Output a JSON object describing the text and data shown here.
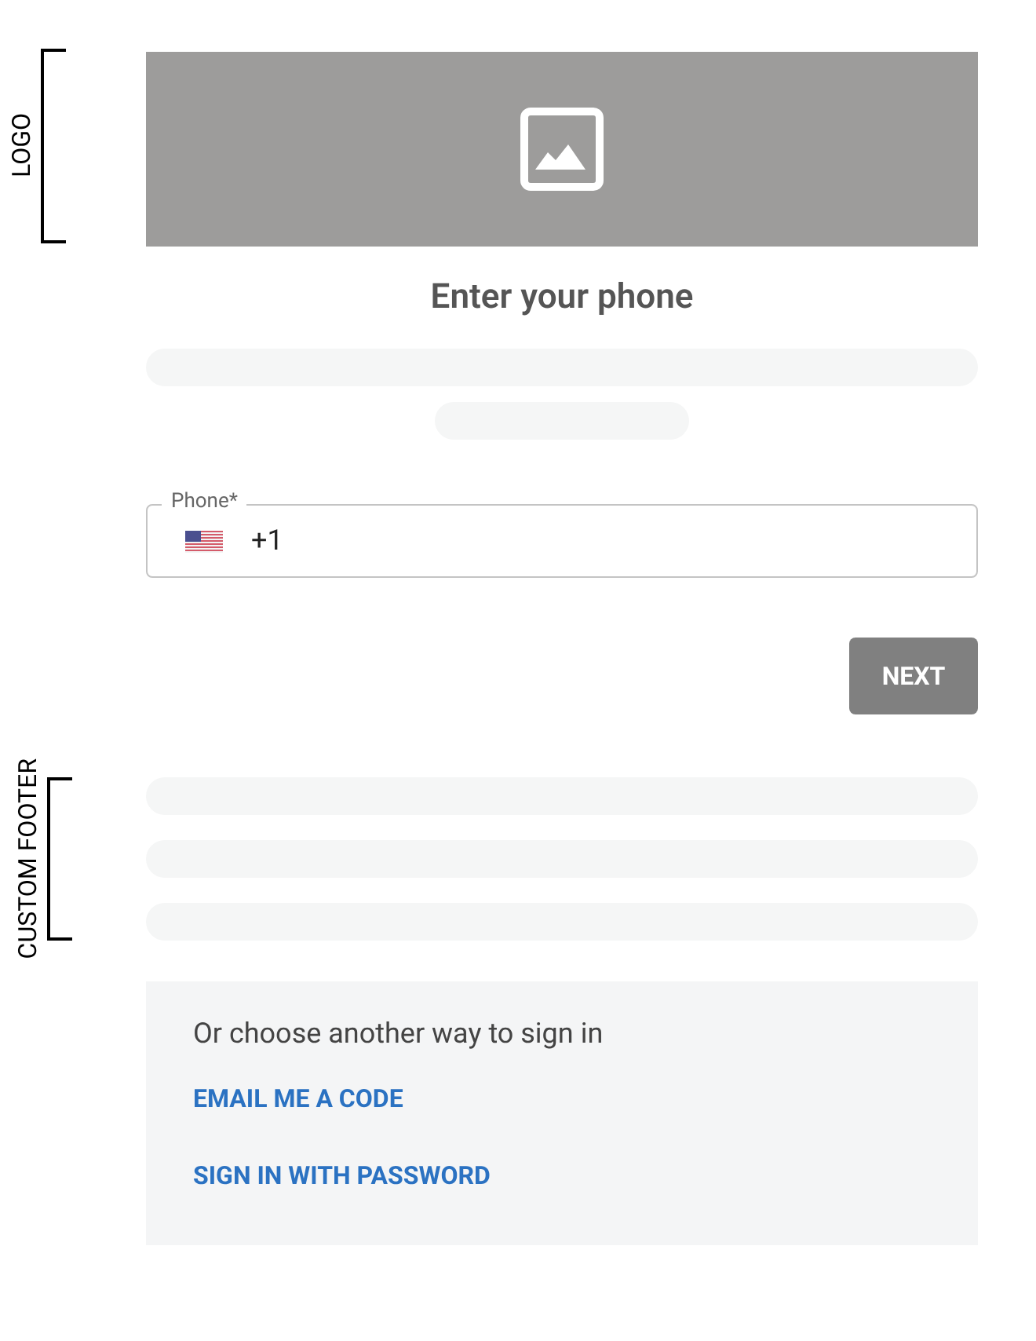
{
  "annotations": [
    {
      "kind": "logo",
      "label": "LOGO"
    },
    {
      "kind": "footer",
      "label": "CUSTOM FOOTER"
    }
  ],
  "title": "Enter your phone",
  "phone_field": {
    "label": "Phone*",
    "value": "+1"
  },
  "next_button": {
    "label": "NEXT",
    "disabled": true
  },
  "alternatives": {
    "heading": "Or choose another way to sign in",
    "links": [
      "EMAIL ME A CODE",
      "SIGN IN WITH PASSWORD"
    ]
  }
}
